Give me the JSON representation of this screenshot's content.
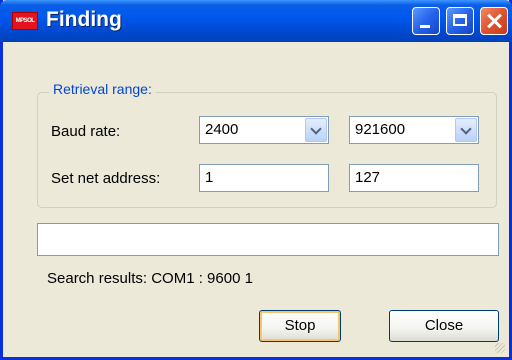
{
  "window": {
    "title": "Finding",
    "app_icon_text": "MPSOL"
  },
  "retrieval": {
    "legend": "Retrieval range:",
    "baud_rate_label": "Baud rate:",
    "baud_rate_from": "2400",
    "baud_rate_to": "921600",
    "net_address_label": "Set net address:",
    "net_address_from": "1",
    "net_address_to": "127"
  },
  "path_field_value": "",
  "search_results": "Search results:  COM1 : 9600 1",
  "buttons": {
    "stop": "Stop",
    "close": "Close"
  },
  "icons": {
    "minimize": "minimize-icon",
    "maximize": "maximize-icon",
    "close": "close-icon",
    "dropdown": "chevron-down-icon"
  },
  "colors": {
    "titlebar": "#0058ee",
    "window_bg": "#ece9d8",
    "legend_text": "#0046d5",
    "close_button": "#e0532f"
  }
}
